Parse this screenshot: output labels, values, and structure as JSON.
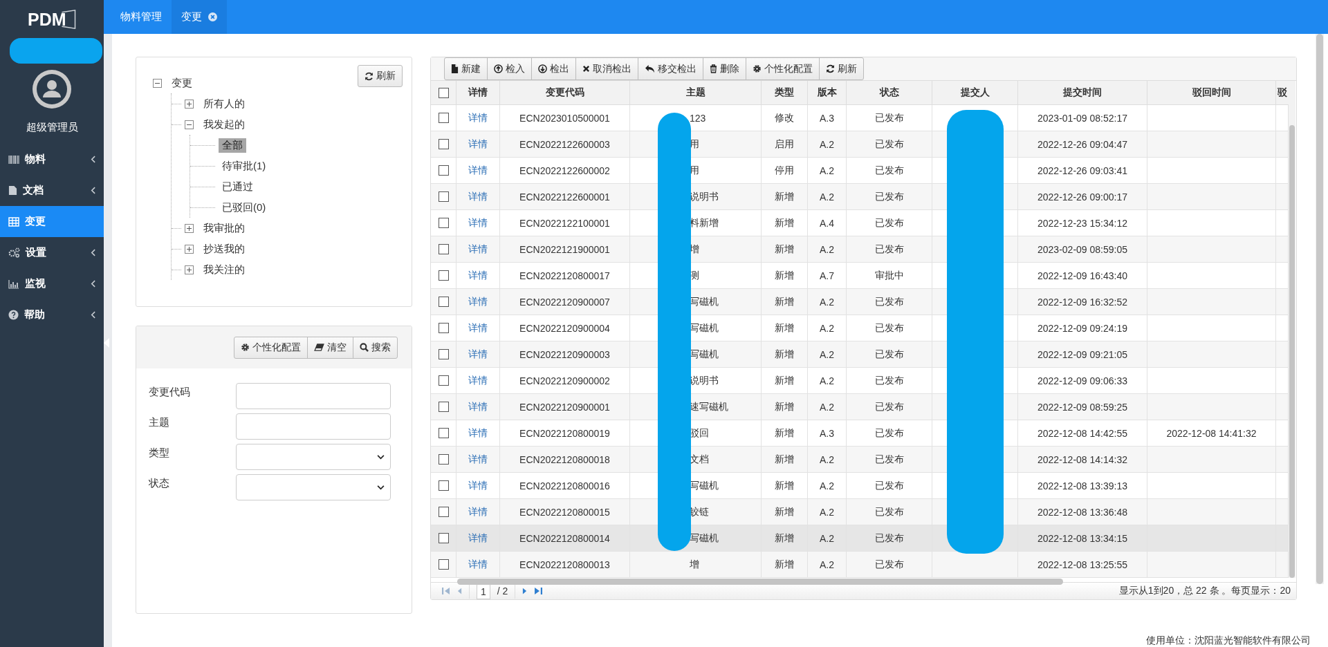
{
  "sidebar": {
    "logo": "PDM",
    "user": "超级管理员",
    "items": [
      {
        "label": "物料",
        "selected": false
      },
      {
        "label": "文档",
        "selected": false
      },
      {
        "label": "变更",
        "selected": true
      },
      {
        "label": "设置",
        "selected": false
      },
      {
        "label": "监视",
        "selected": false
      },
      {
        "label": "帮助",
        "selected": false
      }
    ]
  },
  "tabs": [
    {
      "label": "物料管理",
      "selected": false,
      "closable": false
    },
    {
      "label": "变更",
      "selected": true,
      "closable": true
    }
  ],
  "tree": {
    "refresh": "刷新",
    "nodes": [
      {
        "label": "变更",
        "expanded": true,
        "selected": false,
        "children": [
          {
            "label": "所有人的",
            "expanded": false,
            "selected": false
          },
          {
            "label": "我发起的",
            "expanded": true,
            "selected": false,
            "children": [
              {
                "label": "全部",
                "selected": true
              },
              {
                "label": "待审批(1)",
                "selected": false
              },
              {
                "label": "已通过",
                "selected": false
              },
              {
                "label": "已驳回(0)",
                "selected": false
              }
            ]
          },
          {
            "label": "我审批的",
            "expanded": false,
            "selected": false
          },
          {
            "label": "抄送我的",
            "expanded": false,
            "selected": false
          },
          {
            "label": "我关注的",
            "expanded": false,
            "selected": false
          }
        ]
      }
    ]
  },
  "search": {
    "buttons": [
      "个性化配置",
      "清空",
      "搜索"
    ],
    "fields": [
      {
        "label": "变更代码",
        "kind": "text"
      },
      {
        "label": "主题",
        "kind": "text"
      },
      {
        "label": "类型",
        "kind": "select"
      },
      {
        "label": "状态",
        "kind": "select"
      }
    ]
  },
  "toolbar": [
    "新建",
    "检入",
    "检出",
    "取消检出",
    "移交检出",
    "删除",
    "个性化配置",
    "刷新"
  ],
  "table": {
    "header_checked": false,
    "columns": [
      "详情",
      "变更代码",
      "主题",
      "类型",
      "版本",
      "状态",
      "提交人",
      "提交时间",
      "驳回时间",
      "驳"
    ],
    "rows": [
      {
        "checked": false,
        "hovered": false,
        "cells": [
          "详情",
          "ECN2023010500001",
          "123",
          "修改",
          "A.3",
          "已发布",
          "",
          "2023-01-09 08:52:17",
          ""
        ]
      },
      {
        "checked": false,
        "hovered": false,
        "cells": [
          "详情",
          "ECN2022122600003",
          "用",
          "启用",
          "A.2",
          "已发布",
          "",
          "2022-12-26 09:04:47",
          ""
        ]
      },
      {
        "checked": false,
        "hovered": false,
        "cells": [
          "详情",
          "ECN2022122600002",
          "用",
          "停用",
          "A.2",
          "已发布",
          "",
          "2022-12-26 09:03:41",
          ""
        ]
      },
      {
        "checked": false,
        "hovered": false,
        "cells": [
          "详情",
          "ECN2022122600001",
          "说明书",
          "新增",
          "A.2",
          "已发布",
          "",
          "2022-12-26 09:00:17",
          ""
        ]
      },
      {
        "checked": false,
        "hovered": false,
        "cells": [
          "详情",
          "ECN2022122100001",
          "料新增",
          "新增",
          "A.4",
          "已发布",
          "",
          "2022-12-23 15:34:12",
          ""
        ]
      },
      {
        "checked": false,
        "hovered": false,
        "cells": [
          "详情",
          "ECN2022121900001",
          "增",
          "新增",
          "A.2",
          "已发布",
          "",
          "2023-02-09 08:59:05",
          ""
        ]
      },
      {
        "checked": false,
        "hovered": false,
        "cells": [
          "详情",
          "ECN2022120800017",
          "测",
          "新增",
          "A.7",
          "审批中",
          "",
          "2022-12-09 16:43:40",
          ""
        ]
      },
      {
        "checked": false,
        "hovered": false,
        "cells": [
          "详情",
          "ECN2022120900007",
          "写磁机",
          "新增",
          "A.2",
          "已发布",
          "",
          "2022-12-09 16:32:52",
          ""
        ]
      },
      {
        "checked": false,
        "hovered": false,
        "cells": [
          "详情",
          "ECN2022120900004",
          "写磁机",
          "新增",
          "A.2",
          "已发布",
          "",
          "2022-12-09 09:24:19",
          ""
        ]
      },
      {
        "checked": false,
        "hovered": false,
        "cells": [
          "详情",
          "ECN2022120900003",
          "写磁机",
          "新增",
          "A.2",
          "已发布",
          "",
          "2022-12-09 09:21:05",
          ""
        ]
      },
      {
        "checked": false,
        "hovered": false,
        "cells": [
          "详情",
          "ECN2022120900002",
          "说明书",
          "新增",
          "A.2",
          "已发布",
          "",
          "2022-12-09 09:06:33",
          ""
        ]
      },
      {
        "checked": false,
        "hovered": false,
        "cells": [
          "详情",
          "ECN2022120900001",
          "速写磁机",
          "新增",
          "A.2",
          "已发布",
          "",
          "2022-12-09 08:59:25",
          ""
        ]
      },
      {
        "checked": false,
        "hovered": false,
        "cells": [
          "详情",
          "ECN2022120800019",
          "驳回",
          "新增",
          "A.3",
          "已发布",
          "",
          "2022-12-08 14:42:55",
          "2022-12-08 14:41:32"
        ]
      },
      {
        "checked": false,
        "hovered": false,
        "cells": [
          "详情",
          "ECN2022120800018",
          "文档",
          "新增",
          "A.2",
          "已发布",
          "",
          "2022-12-08 14:14:32",
          ""
        ]
      },
      {
        "checked": false,
        "hovered": false,
        "cells": [
          "详情",
          "ECN2022120800016",
          "写磁机",
          "新增",
          "A.2",
          "已发布",
          "",
          "2022-12-08 13:39:13",
          ""
        ]
      },
      {
        "checked": false,
        "hovered": false,
        "cells": [
          "详情",
          "ECN2022120800015",
          "铰链",
          "新增",
          "A.2",
          "已发布",
          "",
          "2022-12-08 13:36:48",
          ""
        ]
      },
      {
        "checked": false,
        "hovered": true,
        "cells": [
          "详情",
          "ECN2022120800014",
          "写磁机",
          "新增",
          "A.2",
          "已发布",
          "",
          "2022-12-08 13:34:15",
          ""
        ]
      },
      {
        "checked": false,
        "hovered": false,
        "cells": [
          "详情",
          "ECN2022120800013",
          "增",
          "新增",
          "A.2",
          "已发布",
          "",
          "2022-12-08 13:25:55",
          ""
        ]
      }
    ]
  },
  "pager": {
    "page": "1",
    "total_pages": "/ 2",
    "summary": "显示从1到20，总 22 条 。每页显示：20"
  },
  "footer": "使用单位：沈阳蓝光智能软件有限公司"
}
